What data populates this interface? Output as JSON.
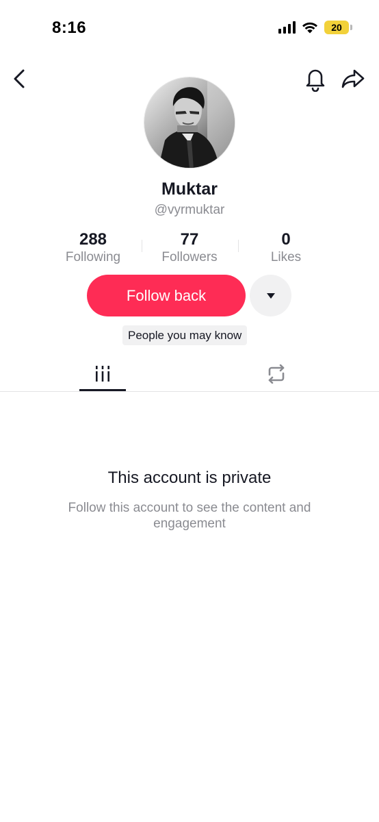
{
  "status_bar": {
    "time": "8:16",
    "battery_level": "20",
    "icons": [
      "cellular-signal-icon",
      "wifi-icon",
      "battery-icon"
    ]
  },
  "nav": {
    "back_icon": "chevron-left-icon",
    "notify_icon": "bell-icon",
    "share_icon": "share-arrow-icon"
  },
  "profile": {
    "display_name": "Muktar",
    "username": "@vyrmuktar"
  },
  "stats": [
    {
      "value": "288",
      "label": "Following"
    },
    {
      "value": "77",
      "label": "Followers"
    },
    {
      "value": "0",
      "label": "Likes"
    }
  ],
  "actions": {
    "follow_label": "Follow back",
    "more_icon": "caret-down-icon",
    "suggestion_label": "People you may know"
  },
  "tabs": [
    {
      "name": "videos",
      "icon": "grid-lines-icon",
      "active": true
    },
    {
      "name": "reposts",
      "icon": "repost-icon",
      "active": false
    }
  ],
  "private_notice": {
    "title": "This account is private",
    "description": "Follow this account to see the content and engagement"
  },
  "colors": {
    "accent": "#fe2c55",
    "text_primary": "#161823",
    "text_secondary": "#8a8b91",
    "battery": "#f2d13a"
  }
}
